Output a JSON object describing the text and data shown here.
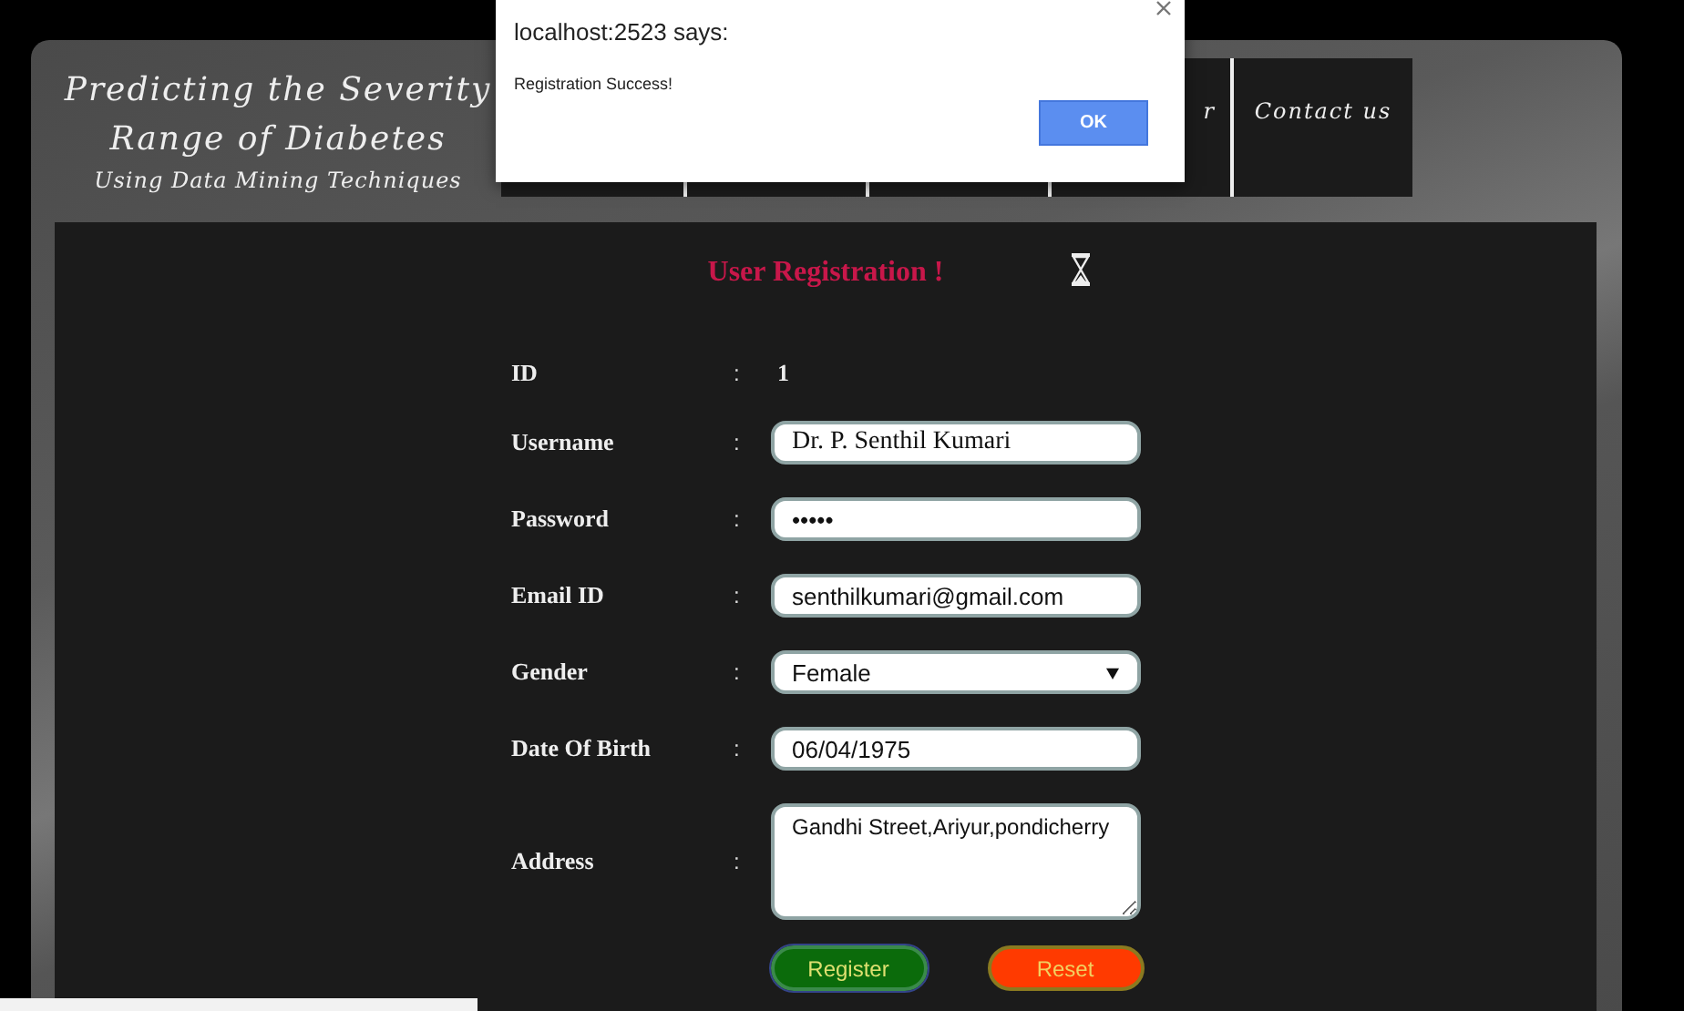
{
  "logo": [
    "Predicting the Severity",
    "Range of Diabetes",
    "Using Data Mining Techniques"
  ],
  "nav": [
    {
      "kind": "blank"
    },
    {
      "kind": "blank"
    },
    {
      "kind": "blank"
    },
    {
      "kind": "partial",
      "label": "r"
    },
    {
      "kind": "tab",
      "label": "Contact us"
    }
  ],
  "dialog": {
    "title": "localhost:2523 says:",
    "message": "Registration Success!",
    "button": "OK"
  },
  "form": {
    "title": "User Registration !",
    "fields": [
      {
        "kind": "static",
        "label": "ID",
        "separator": ":",
        "value": "1"
      },
      {
        "kind": "text",
        "label": "Username",
        "separator": ":",
        "value": "Dr. P. Senthil Kumari"
      },
      {
        "kind": "text",
        "label": "Password",
        "separator": ":",
        "value": "•••••"
      },
      {
        "kind": "text",
        "label": "Email ID",
        "separator": ":",
        "value": "senthilkumari@gmail.com"
      },
      {
        "kind": "select",
        "label": "Gender",
        "separator": ":",
        "value": "Female"
      },
      {
        "kind": "text",
        "label": "Date Of Birth",
        "separator": ":",
        "value": "06/04/1975"
      },
      {
        "kind": "textarea",
        "label": "Address",
        "separator": ":",
        "value": "Gandhi Street,Ariyur,pondicherry"
      }
    ],
    "buttons": [
      {
        "label": "Register",
        "kind": "submit",
        "focused": true
      },
      {
        "label": "Reset",
        "kind": "reset",
        "focused": false
      }
    ]
  }
}
